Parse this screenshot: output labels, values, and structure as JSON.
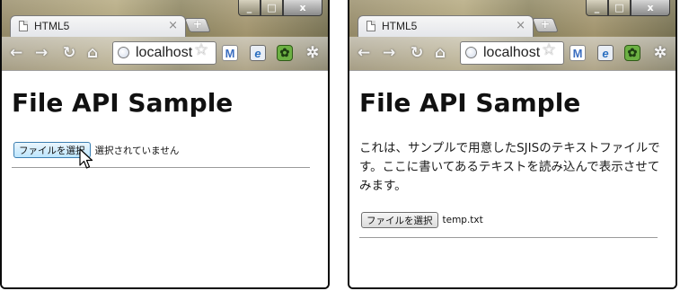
{
  "windows": [
    {
      "tab_title": "HTML5",
      "url": "localhost",
      "page_title": "File API Sample",
      "file_button_label": "ファイルを選択",
      "file_status": "選択されていません",
      "body_text": ""
    },
    {
      "tab_title": "HTML5",
      "url": "localhost",
      "page_title": "File API Sample",
      "file_button_label": "ファイルを選択",
      "file_status": "temp.txt",
      "body_text": "これは、サンプルで用意したSJISのテキストファイルです。ここに書いてあるテキストを読み込んで表示させてみます。"
    }
  ],
  "icons": {
    "tab": "page-icon",
    "close_tab": "close-icon",
    "new_tab": "plus-icon",
    "back": "back-arrow-icon",
    "forward": "forward-arrow-icon",
    "reload": "reload-icon",
    "home": "home-icon",
    "site": "globe-icon",
    "bookmark": "star-icon",
    "extension_1": "gmail-icon",
    "extension_2": "ie-tab-icon",
    "extension_3": "evernote-icon",
    "menu": "wrench-icon",
    "pointer": "mouse-cursor-icon"
  },
  "colors": {
    "frame": "#9a8f6c",
    "button_hover": "#bde6fd",
    "divider": "#9a9a9a"
  }
}
